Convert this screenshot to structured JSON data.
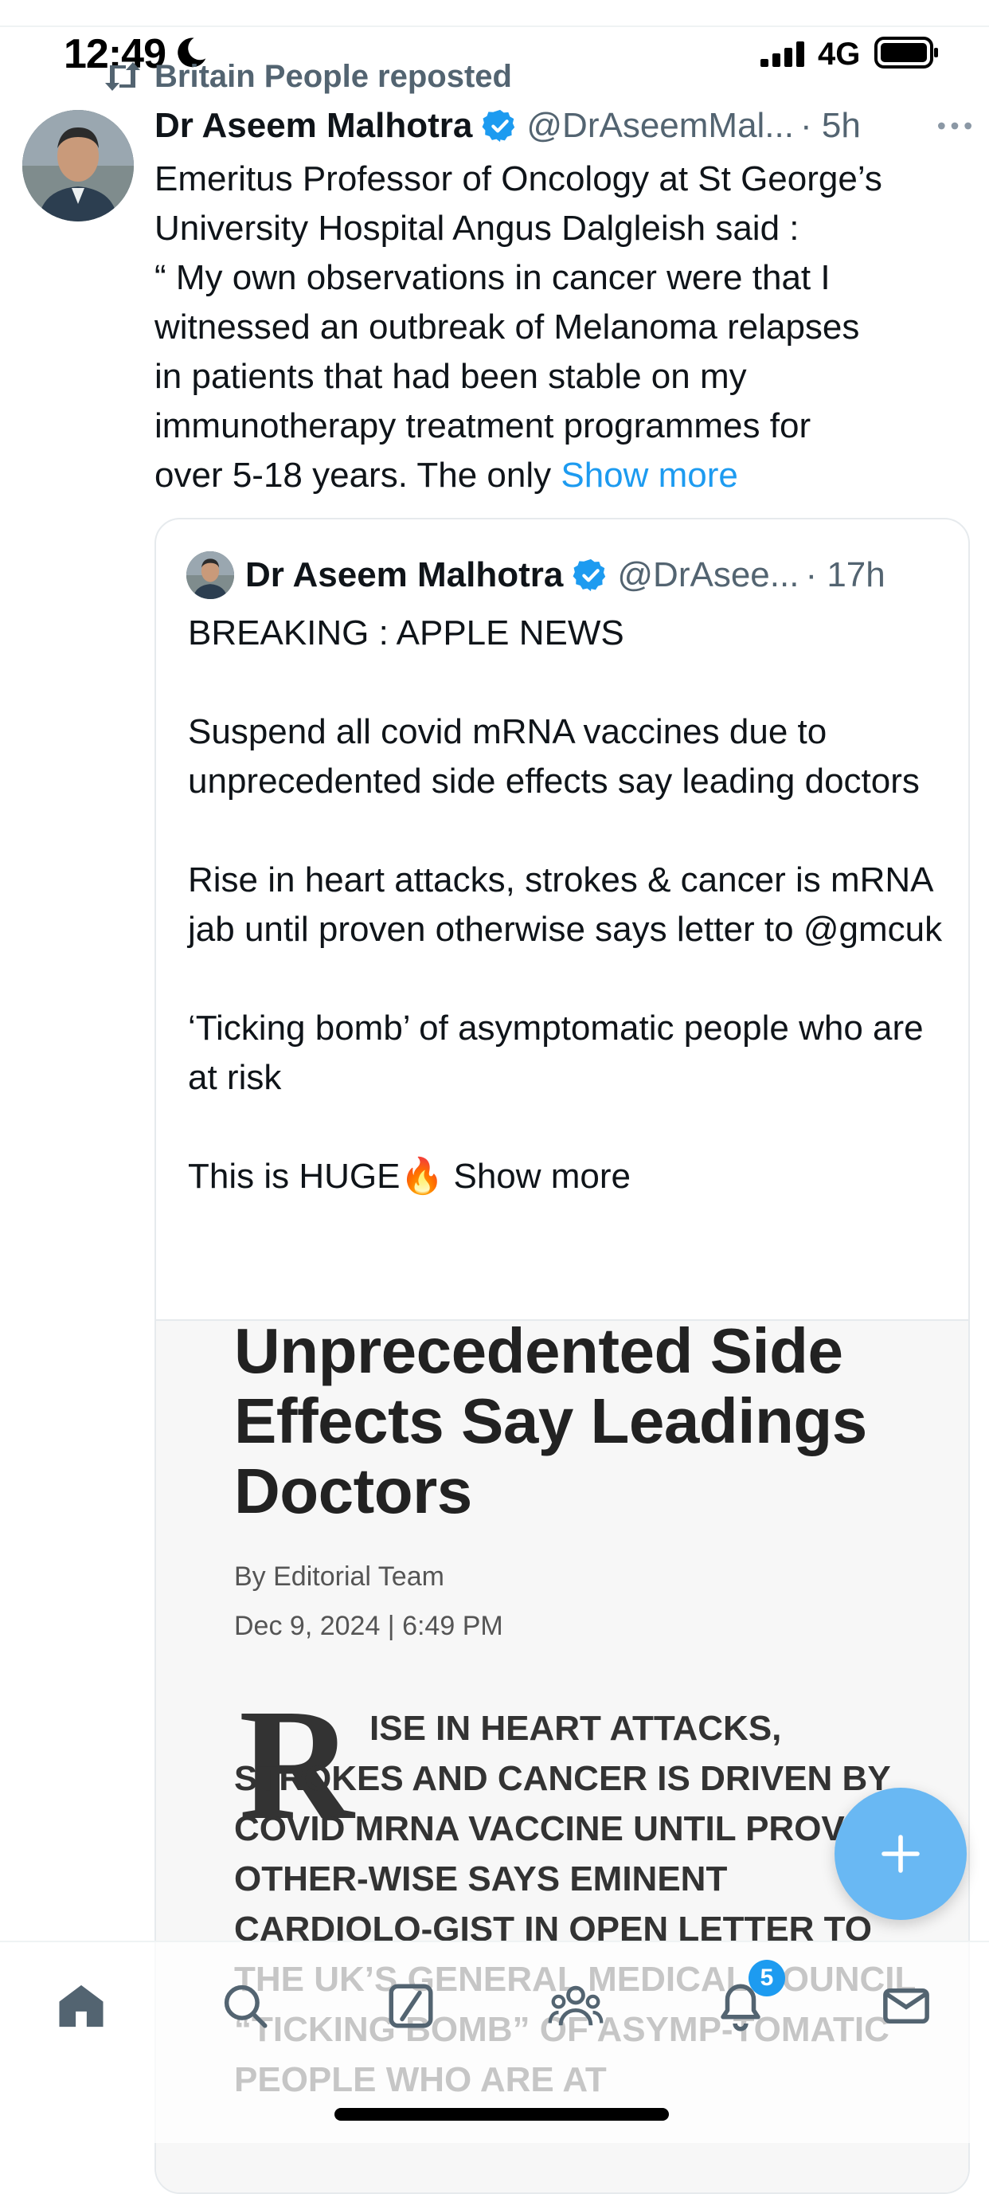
{
  "status_bar": {
    "time": "12:49",
    "network": "4G",
    "icons": [
      "moon-icon",
      "signal-icon",
      "battery-icon"
    ]
  },
  "repost": {
    "icon": "repost-icon",
    "text": "Britain People reposted"
  },
  "tweet": {
    "author_name": "Dr Aseem Malhotra",
    "verified": true,
    "handle": "@DrAseemMal...",
    "time": "· 5h",
    "body_lines": [
      "Emeritus Professor of Oncology at St George’s",
      "University Hospital Angus Dalgleish said :",
      "“ My own observations in cancer were that I",
      "witnessed an outbreak of Melanoma relapses",
      "in patients that had been stable on my",
      "immunotherapy treatment programmes for",
      "over 5-18 years. The only"
    ],
    "show_more": "Show more"
  },
  "quote": {
    "author_name": "Dr Aseem Malhotra",
    "handle": "@DrAsee...",
    "time": "· 17h",
    "paragraphs": [
      "BREAKING : APPLE NEWS",
      "Suspend all covid mRNA vaccines due to unprecedented side effects say leading doctors",
      "Rise in heart attacks, strokes & cancer is mRNA jab until proven otherwise says letter to @gmcuk",
      "‘Ticking bomb’ of asymptomatic people who are at risk"
    ],
    "last_line": "This is HUGE🔥 ",
    "show_more": "Show more"
  },
  "article": {
    "headline": "Unprecedented Side Effects Say Leadings Doctors",
    "byline": "By Editorial Team",
    "date": "Dec 9, 2024 | 6:49 PM",
    "drop_cap": "R",
    "lead": "ISE IN HEART ATTACKS, STROKES AND CANCER IS DRIVEN BY COVID MRNA VACCINE UNTIL PROVEN OTHER-WISE SAYS EMINENT CARDIOLO-GIST IN OPEN LETTER TO THE UK’S GENERAL MEDICAL COUNCIL “TICKING BOMB” OF ASYMP-TOMATIC PEOPLE WHO ARE AT"
  },
  "bottom_nav": {
    "items": [
      "home-icon",
      "search-icon",
      "grok-icon",
      "communities-icon",
      "notifications-icon",
      "messages-icon"
    ],
    "notification_count": "5"
  },
  "colors": {
    "accent": "#1d9bf0",
    "fab": "#69b8f3",
    "muted_text": "#536471"
  }
}
